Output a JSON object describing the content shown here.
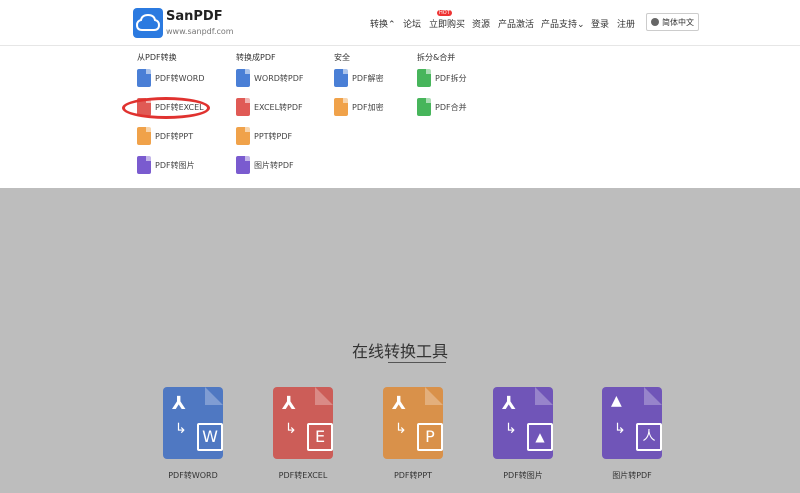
{
  "brand": {
    "name": "SanPDF",
    "url": "www.sanpdf.com"
  },
  "nav": {
    "convert": "转换",
    "forum": "论坛",
    "buy": "立即购买",
    "hot": "HOT",
    "resources": "资源",
    "activate": "产品激活",
    "support": "产品支持",
    "login": "登录",
    "register": "注册",
    "language": "简体中文"
  },
  "dropdown": {
    "columns": [
      {
        "heading": "从PDF转换",
        "items": [
          {
            "label": "PDF转WORD",
            "color": "#4a7fd6"
          },
          {
            "label": "PDF转EXCEL",
            "color": "#e05a55"
          },
          {
            "label": "PDF转PPT",
            "color": "#f0a24a"
          },
          {
            "label": "PDF转图片",
            "color": "#7a5bcf"
          }
        ]
      },
      {
        "heading": "转换成PDF",
        "items": [
          {
            "label": "WORD转PDF",
            "color": "#4a7fd6"
          },
          {
            "label": "EXCEL转PDF",
            "color": "#e05a55"
          },
          {
            "label": "PPT转PDF",
            "color": "#f0a24a"
          },
          {
            "label": "图片转PDF",
            "color": "#7a5bcf"
          }
        ]
      },
      {
        "heading": "安全",
        "items": [
          {
            "label": "PDF解密",
            "color": "#4a7fd6"
          },
          {
            "label": "PDF加密",
            "color": "#f0a24a"
          }
        ]
      },
      {
        "heading": "拆分&合并",
        "items": [
          {
            "label": "PDF拆分",
            "color": "#47b55b"
          },
          {
            "label": "PDF合并",
            "color": "#47b55b"
          }
        ]
      }
    ]
  },
  "tools": {
    "title": "在线转换工具",
    "cards": [
      {
        "label": "PDF转WORD",
        "badge": "W",
        "color": "#4f78c2"
      },
      {
        "label": "PDF转EXCEL",
        "badge": "E",
        "color": "#cc5d58"
      },
      {
        "label": "PDF转PPT",
        "badge": "P",
        "color": "#d9914a"
      },
      {
        "label": "PDF转图片",
        "badge": "▲",
        "color": "#7055b8"
      },
      {
        "label": "图片转PDF",
        "badge": "人",
        "color": "#7055b8"
      }
    ]
  }
}
